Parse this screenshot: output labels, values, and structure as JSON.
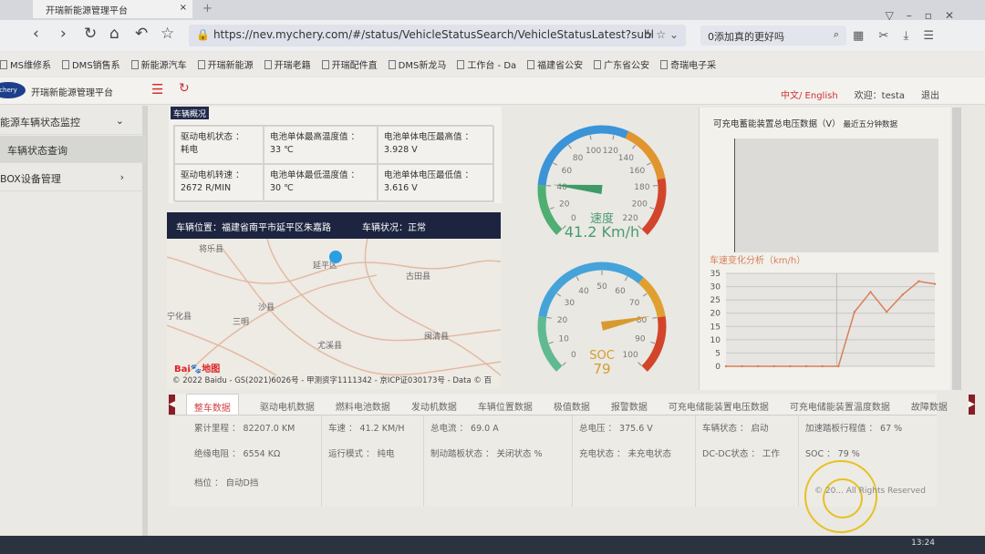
{
  "browser": {
    "tab_title": "开瑞新能源管理平台",
    "tab_close": "×",
    "new_tab": "+",
    "url": "https://nev.mychery.com/#/status/VehicleStatusSearch/VehicleStatusLatest?subl",
    "search_placeholder": "0添加真的更好吗",
    "bookmarks": [
      "MS维修系",
      "DMS销售系",
      "新能源汽车",
      "开瑞新能源",
      "开瑞老籍",
      "开瑞配件直",
      "DMS新龙马",
      "工作台 - Da",
      "福建省公安",
      "广东省公安",
      "奇瑞电子采"
    ]
  },
  "header": {
    "logo": "chery",
    "title": "开瑞新能源管理平台",
    "lang": "中文/ English",
    "welcome": "欢迎：testa",
    "logout": "退出"
  },
  "sidebar": {
    "items": [
      {
        "label": "能源车辆状态监控",
        "chevron": "⌄"
      },
      {
        "label": "车辆状态查询"
      },
      {
        "label": "BOX设备管理",
        "chevron": "›"
      }
    ]
  },
  "overview": {
    "title": "车辆概况",
    "cells": [
      {
        "label": "驱动电机状态 ：",
        "value": "耗电"
      },
      {
        "label": "电池单体最高温度值 ：",
        "value": "33 ℃"
      },
      {
        "label": "电池单体电压最高值 ：",
        "value": "3.928 V"
      },
      {
        "label": "驱动电机转速 ：",
        "value": "2672 R/MIN"
      },
      {
        "label": "电池单体最低温度值 ：",
        "value": "30 ℃"
      },
      {
        "label": "电池单体电压最低值 ：",
        "value": "3.616 V"
      }
    ]
  },
  "location": {
    "position": "车辆位置：福建省南平市延平区朱嘉路",
    "status": "车辆状况：正常"
  },
  "map": {
    "labels": [
      "将乐县",
      "延平区",
      "古田县",
      "沙县",
      "三明",
      "宁化县",
      "尤溪县",
      "闽清县"
    ],
    "logo": "Bai du 地图",
    "copyright": "© 2022 Baidu - GS(2021)6026号 - 甲测资字1111342 - 京ICP证030173号 - Data © 百"
  },
  "gauges": [
    {
      "name": "速度",
      "value": 41.2,
      "display": "41.2 Km/h",
      "min": 0,
      "max": 220,
      "ticks": [
        0,
        20,
        40,
        60,
        80,
        100,
        120,
        140,
        160,
        180,
        200,
        220
      ],
      "bands": [
        [
          40,
          "#4fae72"
        ],
        [
          130,
          "#3b93d8"
        ],
        [
          175,
          "#e0952e"
        ],
        [
          220,
          "#d2452b"
        ]
      ],
      "pointer_color": "#3f9a67",
      "value_color": "#4a9a70"
    },
    {
      "name": "SOC",
      "value": 79,
      "display": "79",
      "min": 0,
      "max": 100,
      "ticks": [
        0,
        10,
        20,
        30,
        40,
        50,
        60,
        70,
        80,
        90,
        100
      ],
      "bands": [
        [
          20,
          "#5fba92"
        ],
        [
          65,
          "#45a3d9"
        ],
        [
          80,
          "#e0a030"
        ],
        [
          100,
          "#d2452b"
        ]
      ],
      "pointer_color": "#d89a30",
      "value_color": "#d89a30"
    }
  ],
  "voltage_chart": {
    "title": "可充电蓄能装置总电压数据（V）",
    "subtitle": "最近五分钟数据"
  },
  "chart_data": {
    "type": "line",
    "title": "车速变化分析（km/h）",
    "ylim": [
      0,
      35
    ],
    "yticks": [
      0,
      5,
      10,
      15,
      20,
      25,
      30,
      35
    ],
    "grid": true,
    "values": [
      0,
      0,
      0,
      0,
      0,
      0,
      0,
      0,
      20.5,
      28,
      20.5,
      27,
      32,
      31
    ],
    "color": "#d7805a"
  },
  "bottom_tabs": [
    "整车数据",
    "驱动电机数据",
    "燃料电池数据",
    "发动机数据",
    "车辆位置数据",
    "极值数据",
    "报警数据",
    "可充电储能装置电压数据",
    "可充电储能装置温度数据",
    "故障数据"
  ],
  "vehicle_data": [
    "累计里程 ： 82207.0 KM",
    "车速 ： 41.2 KM/H",
    "总电流 ： 69.0 A",
    "总电压 ： 375.6 V",
    "车辆状态 ： 启动",
    "加速踏板行程值 ： 67 %",
    "绝缘电阻 ： 6554 KΩ",
    "运行模式 ： 纯电",
    "制动踏板状态 ： 关闭状态 %",
    "充电状态 ： 未充电状态",
    "DC-DC状态 ： 工作",
    "SOC ： 79 %",
    "档位 ： 自动D挡"
  ],
  "footer": "© 20... All Rights Reserved",
  "clock": "13:24"
}
